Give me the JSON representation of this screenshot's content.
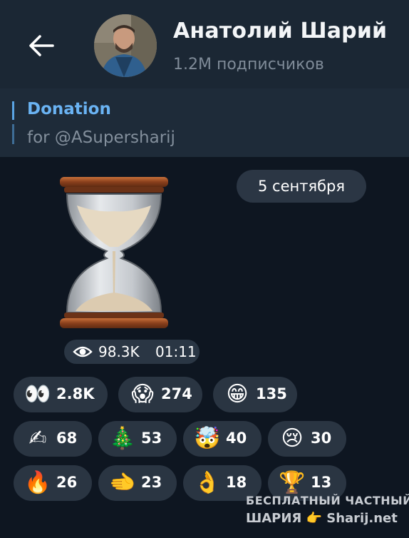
{
  "header": {
    "title": "Анатолий Шарий",
    "subscribers": "1.2M подписчиков"
  },
  "pinned": {
    "title": "Donation",
    "text": "for @ASupersharij"
  },
  "message": {
    "date": "5 сентября",
    "views": "98.3K",
    "time": "01:11"
  },
  "reactions": [
    {
      "emoji": "👀",
      "count": "2.8K"
    },
    {
      "emoji": "😱",
      "count": "274"
    },
    {
      "emoji": "😁",
      "count": "135"
    },
    {
      "emoji": "✍",
      "count": "68"
    },
    {
      "emoji": "🎄",
      "count": "53"
    },
    {
      "emoji": "🤯",
      "count": "40"
    },
    {
      "emoji": "😢",
      "count": "30"
    },
    {
      "emoji": "🔥",
      "count": "26"
    },
    {
      "emoji": "🫲",
      "count": "23"
    },
    {
      "emoji": "👌",
      "count": "18"
    },
    {
      "emoji": "🏆",
      "count": "13"
    }
  ],
  "watermark": {
    "line1": "БЕСПЛАТНЫЙ ЧАСТНЫЙ",
    "line2": "ШАРИЯ 👉 Sharij.net"
  }
}
